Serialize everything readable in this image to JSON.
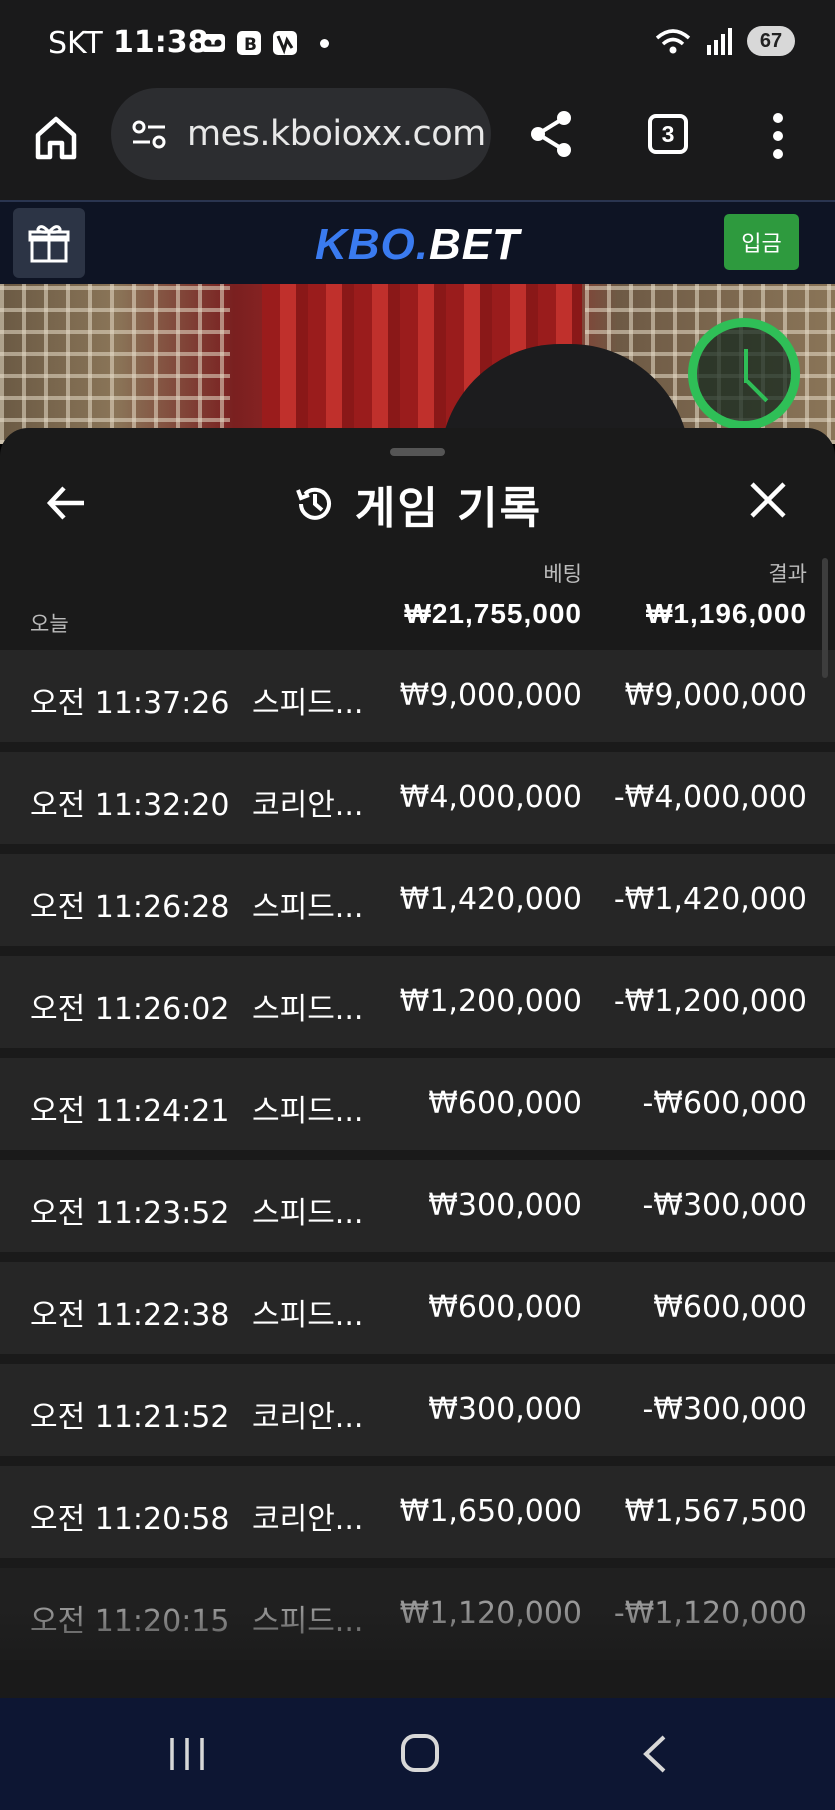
{
  "status_bar": {
    "carrier": "SKT",
    "time": "11:38",
    "battery": "67"
  },
  "browser": {
    "url": "mes.kboioxx.com",
    "tab_count": "3"
  },
  "site_header": {
    "logo_part1": "KBO.",
    "logo_part2": "BET",
    "deposit_label": "입금"
  },
  "history_sheet": {
    "title": "게임 기록",
    "col_bet": "베팅",
    "col_result": "결과",
    "today_label": "오늘",
    "total_bet": "₩21,755,000",
    "total_result": "₩1,196,000",
    "rows": [
      {
        "time": "오전 11:37:26",
        "game": "스피드...",
        "bet": "₩9,000,000",
        "result": "₩9,000,000"
      },
      {
        "time": "오전 11:32:20",
        "game": "코리안...",
        "bet": "₩4,000,000",
        "result": "-₩4,000,000"
      },
      {
        "time": "오전 11:26:28",
        "game": "스피드...",
        "bet": "₩1,420,000",
        "result": "-₩1,420,000"
      },
      {
        "time": "오전 11:26:02",
        "game": "스피드...",
        "bet": "₩1,200,000",
        "result": "-₩1,200,000"
      },
      {
        "time": "오전 11:24:21",
        "game": "스피드...",
        "bet": "₩600,000",
        "result": "-₩600,000"
      },
      {
        "time": "오전 11:23:52",
        "game": "스피드...",
        "bet": "₩300,000",
        "result": "-₩300,000"
      },
      {
        "time": "오전 11:22:38",
        "game": "스피드...",
        "bet": "₩600,000",
        "result": "₩600,000"
      },
      {
        "time": "오전 11:21:52",
        "game": "코리안...",
        "bet": "₩300,000",
        "result": "-₩300,000"
      },
      {
        "time": "오전 11:20:58",
        "game": "코리안...",
        "bet": "₩1,650,000",
        "result": "₩1,567,500"
      },
      {
        "time": "오전 11:20:15",
        "game": "스피드...",
        "bet": "₩1,120,000",
        "result": "-₩1,120,000"
      }
    ]
  },
  "colors": {
    "deposit_green": "#2e9a3e",
    "logo_blue": "#3a7bf0",
    "timer_green": "#2fbf57"
  },
  "icons": [
    "home-icon",
    "site-settings-icon",
    "share-icon",
    "tabs-icon",
    "more-menu-icon",
    "gift-icon",
    "timer-icon",
    "back-arrow-icon",
    "history-icon",
    "close-icon",
    "nav-recent-icon",
    "nav-home-icon",
    "nav-back-icon"
  ]
}
